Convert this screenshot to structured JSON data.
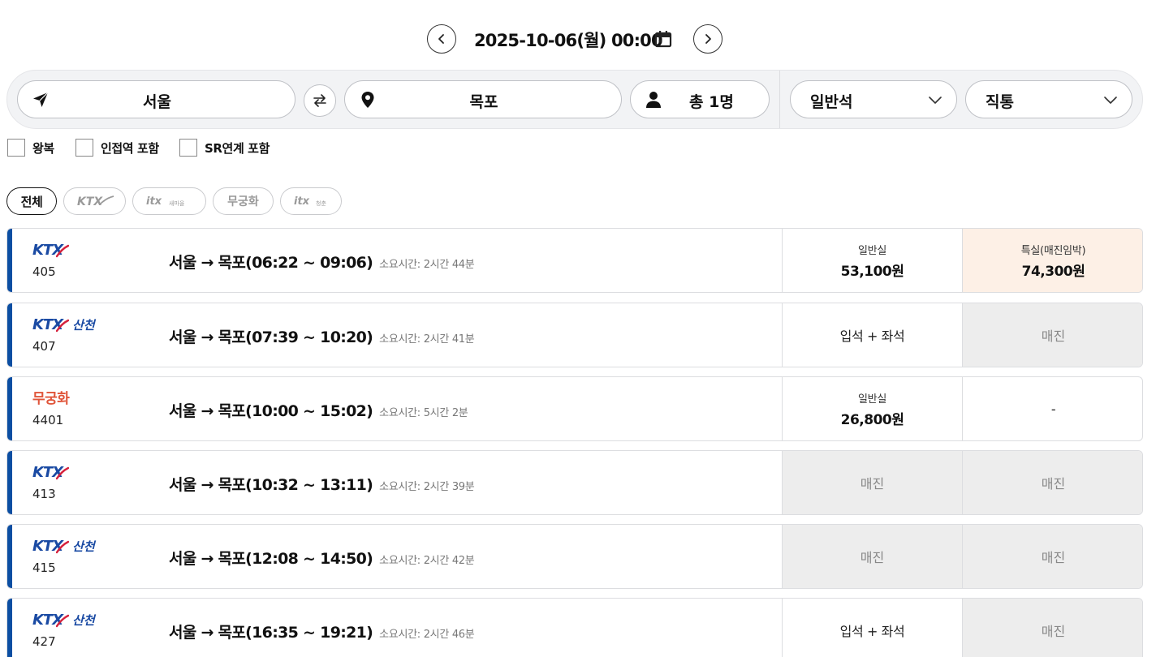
{
  "date_bar": {
    "date_text": "2025-10-06(월) 00:00"
  },
  "search": {
    "origin": "서울",
    "destination": "목포",
    "passengers": "총 1명",
    "seat_class": "일반석",
    "route_type": "직통"
  },
  "options": {
    "round_trip": "왕복",
    "nearby_station": "인접역 포함",
    "sr_link": "SR연계 포함"
  },
  "filters": {
    "all": "전체",
    "ktx": "KTX",
    "itx_saemaeul": "ITX 새마을",
    "mugunghwa": "무궁화",
    "itx_cheongchun": "ITX 청춘"
  },
  "colors": {
    "accent": "#0b4ea2",
    "ktx_blue": "#1a4aa3",
    "ktx_red": "#d6213c",
    "mugunghwa_orange": "#e0553a",
    "soldout_bg": "#ededed",
    "special_bg": "#fdf0e6"
  },
  "trains": [
    {
      "brand": "KTX",
      "brand_type": "ktx",
      "number": "405",
      "route": "서울 → 목포(06:22 ~ 09:06)",
      "duration": "소요시간: 2시간 44분",
      "general": {
        "status": "price",
        "label": "일반실",
        "value": "53,100원"
      },
      "special": {
        "status": "price-special",
        "label": "특실(매진임박)",
        "value": "74,300원"
      }
    },
    {
      "brand": "KTX",
      "brand_sub": "산천",
      "brand_type": "ktx-sancheon",
      "number": "407",
      "route": "서울 → 목포(07:39 ~ 10:20)",
      "duration": "소요시간: 2시간 41분",
      "general": {
        "status": "text",
        "value": "입석 + 좌석"
      },
      "special": {
        "status": "soldout",
        "value": "매진"
      }
    },
    {
      "brand": "무궁화",
      "brand_type": "mugunghwa",
      "number": "4401",
      "route": "서울 → 목포(10:00 ~ 15:02)",
      "duration": "소요시간: 5시간 2분",
      "general": {
        "status": "price",
        "label": "일반실",
        "value": "26,800원"
      },
      "special": {
        "status": "text",
        "value": "-"
      }
    },
    {
      "brand": "KTX",
      "brand_type": "ktx",
      "number": "413",
      "route": "서울 → 목포(10:32 ~ 13:11)",
      "duration": "소요시간: 2시간 39분",
      "general": {
        "status": "soldout",
        "value": "매진"
      },
      "special": {
        "status": "soldout",
        "value": "매진"
      }
    },
    {
      "brand": "KTX",
      "brand_sub": "산천",
      "brand_type": "ktx-sancheon",
      "number": "415",
      "route": "서울 → 목포(12:08 ~ 14:50)",
      "duration": "소요시간: 2시간 42분",
      "general": {
        "status": "soldout",
        "value": "매진"
      },
      "special": {
        "status": "soldout",
        "value": "매진"
      }
    },
    {
      "brand": "KTX",
      "brand_sub": "산천",
      "brand_type": "ktx-sancheon",
      "number": "427",
      "route": "서울 → 목포(16:35 ~ 19:21)",
      "duration": "소요시간: 2시간 46분",
      "general": {
        "status": "text",
        "value": "입석 + 좌석"
      },
      "special": {
        "status": "soldout",
        "value": "매진"
      }
    }
  ]
}
